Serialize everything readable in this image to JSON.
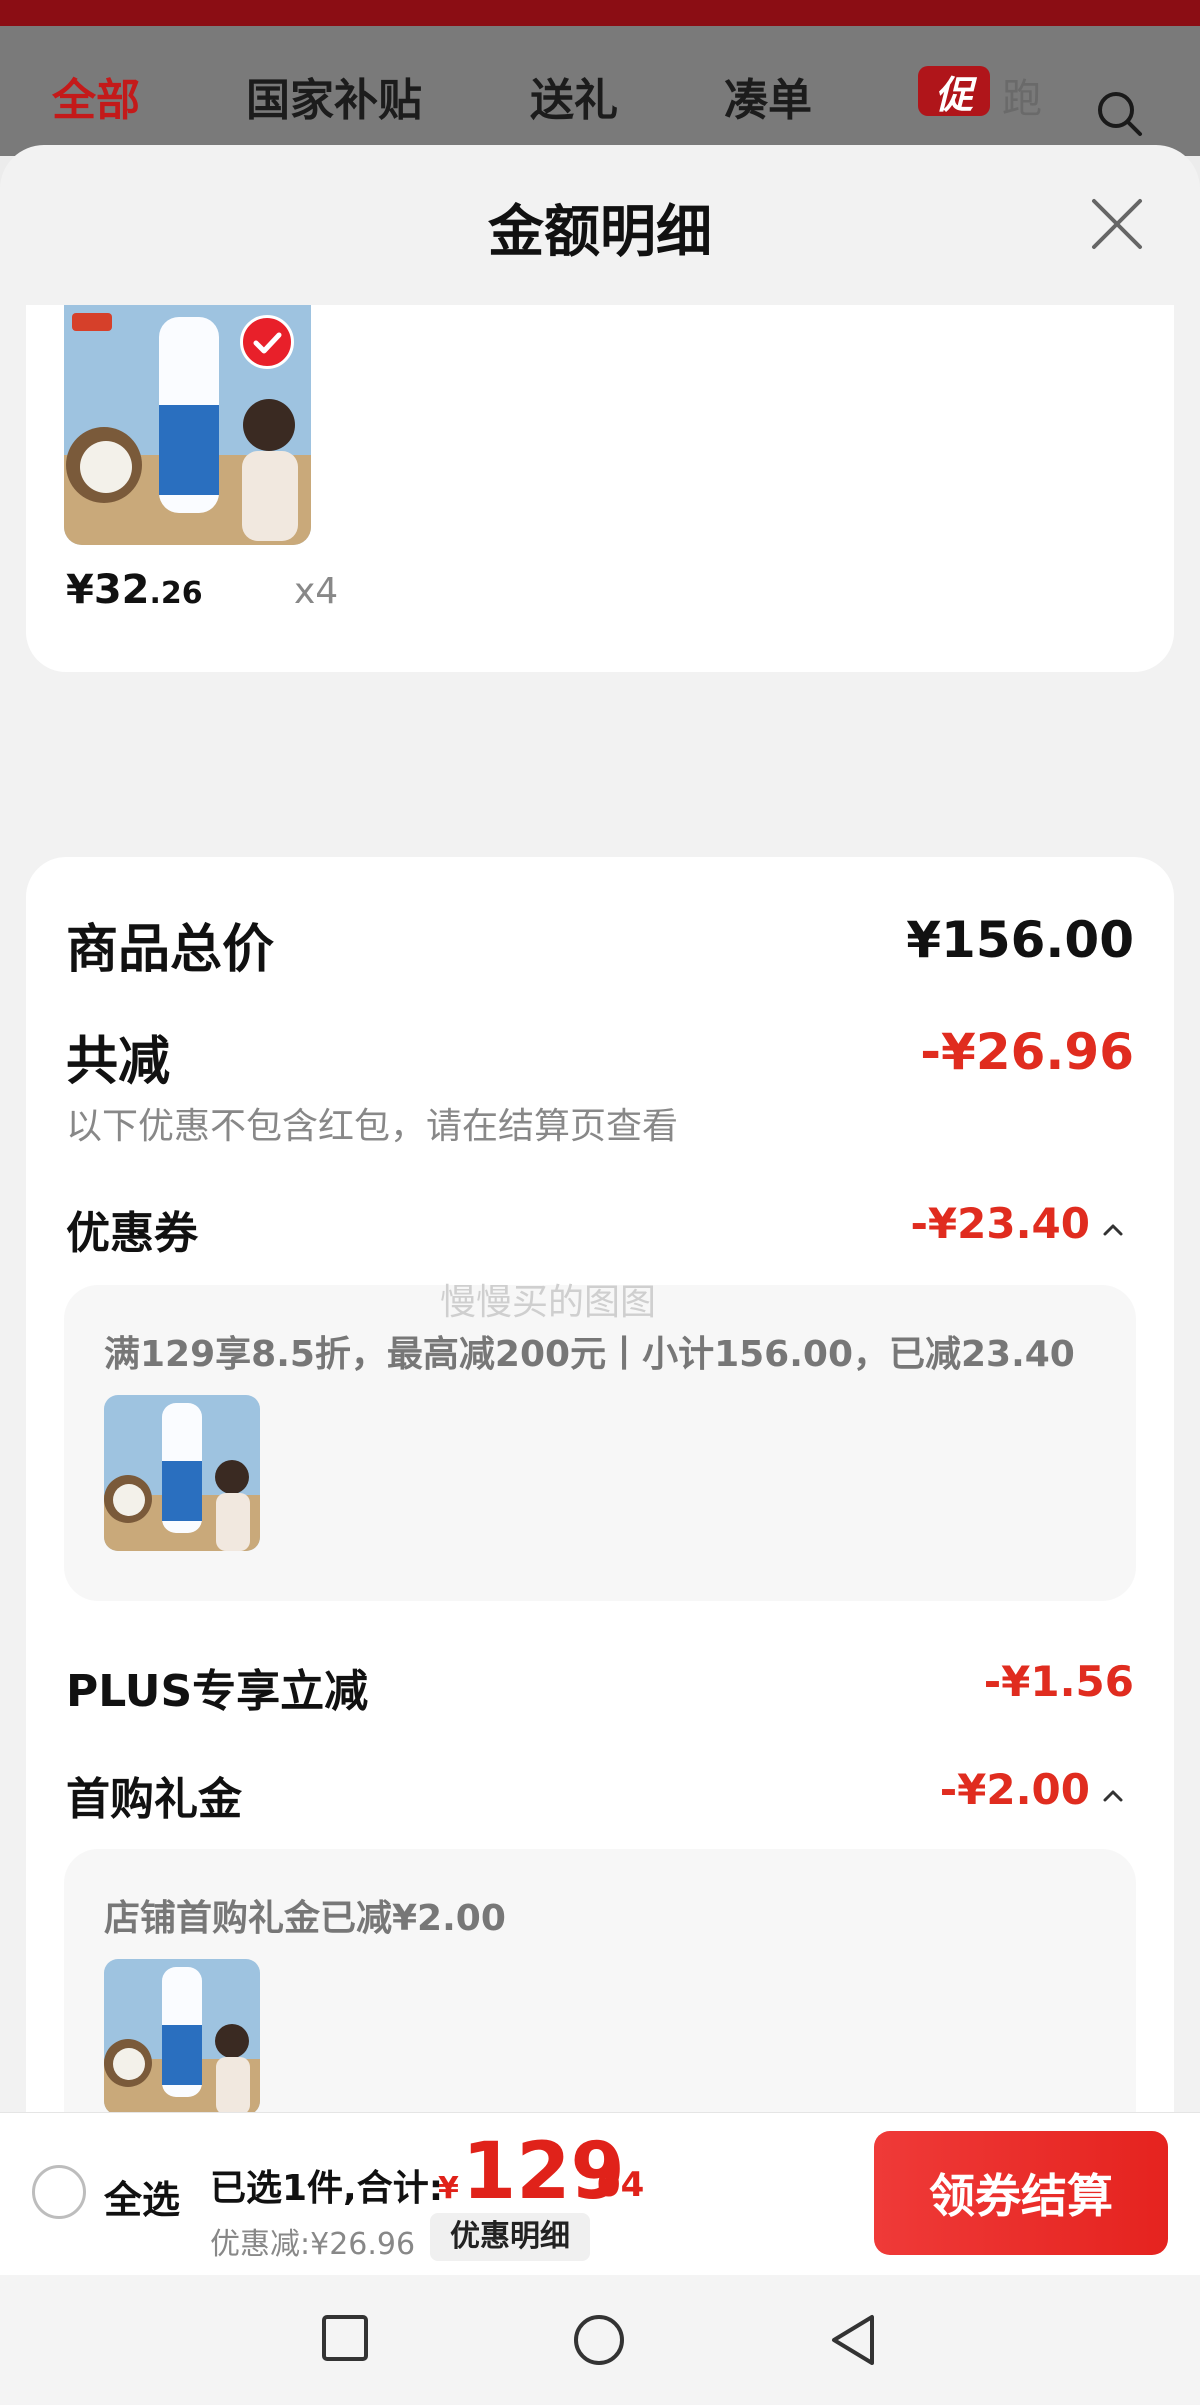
{
  "topnav": {
    "tabs": [
      "全部",
      "国家补贴",
      "送礼",
      "凑单"
    ],
    "promo_badge": "促",
    "promo_tail": "跑"
  },
  "sheet": {
    "title": "金额明细"
  },
  "product": {
    "price_main": "¥32",
    "price_decimal": ".26",
    "quantity": "x4"
  },
  "summary": {
    "total_label": "商品总价",
    "total_value": "¥156.00",
    "reduced_label": "共减",
    "reduced_value": "-¥26.96",
    "note": "以下优惠不包含红包，请在结算页查看",
    "coupon_label": "优惠券",
    "coupon_value": "-¥23.40",
    "coupon_detail": "满129享8.5折，最高减200元丨小计156.00，已减23.40",
    "plus_label": "PLUS专享立减",
    "plus_value": "-¥1.56",
    "firstbuy_label": "首购礼金",
    "firstbuy_value": "-¥2.00",
    "firstbuy_detail": "店铺首购礼金已减¥2.00",
    "watermark": "慢慢买的图图"
  },
  "actionbar": {
    "select_all": "全选",
    "selected_text": "已选1件,合计:",
    "currency": "¥",
    "total_int": "129",
    "total_dec": ".04",
    "saved_text": "优惠减:¥26.96",
    "detail_chip": "优惠明细",
    "checkout": "领券结算"
  },
  "colors": {
    "accent_red": "#e02c1f",
    "brand_dark_red": "#8b0d14"
  },
  "icons": [
    "search-icon",
    "close-icon",
    "check-icon",
    "caret-up-icon",
    "square-nav-icon",
    "circle-nav-icon",
    "back-nav-icon"
  ]
}
